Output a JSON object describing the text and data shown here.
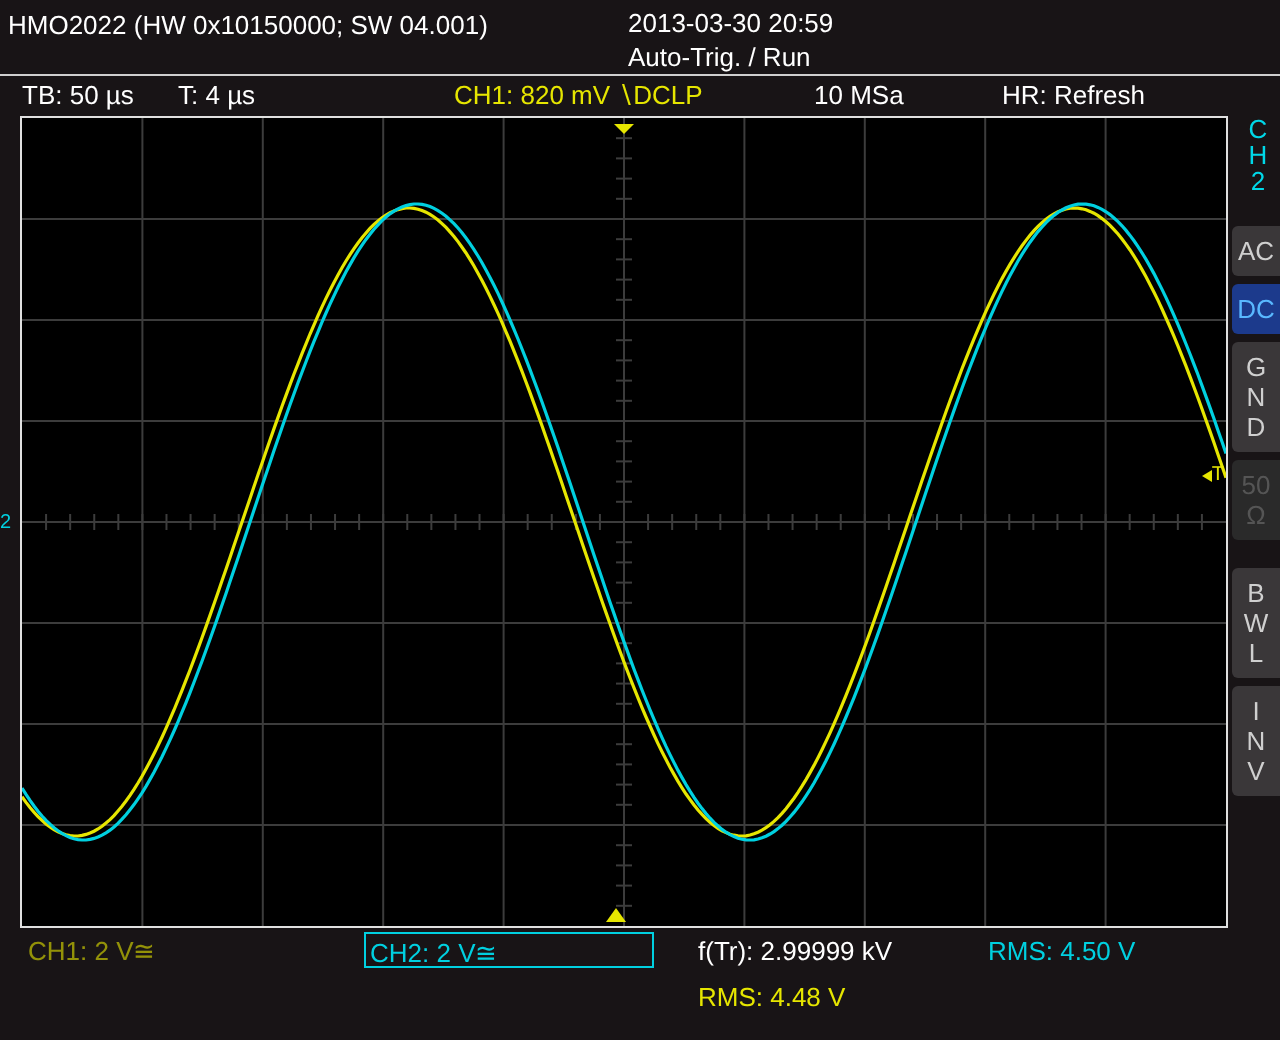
{
  "header": {
    "device": "HMO2022 (HW 0x10150000; SW 04.001)",
    "datetime": "2013-03-30 20:59",
    "trigger_mode": "Auto-Trig. / Run"
  },
  "info_bar": {
    "timebase": "TB: 50 µs",
    "trigger_time": "T: 4 µs",
    "trigger_source": "CH1: 820 mV ∖DCLP",
    "sample_rate": "10 MSa",
    "acquisition": "HR: Refresh"
  },
  "channels": [
    {
      "label": "CH1: 2 V≅",
      "selected": false,
      "color": "#e6e600"
    },
    {
      "label": "CH2: 2 V≅",
      "selected": true,
      "color": "#00d0e0"
    }
  ],
  "markers": {
    "ground_marker": "2",
    "trigger_marker": "T"
  },
  "side_menu": {
    "title": [
      "C",
      "H",
      "2"
    ],
    "buttons": [
      {
        "lines": [
          "AC"
        ],
        "selected": false,
        "disabled": false
      },
      {
        "lines": [
          "DC"
        ],
        "selected": true,
        "disabled": false
      },
      {
        "lines": [
          "G",
          "N",
          "D"
        ],
        "selected": false,
        "disabled": false
      },
      {
        "lines": [
          "50",
          "Ω"
        ],
        "selected": false,
        "disabled": true
      },
      {
        "lines": [
          "B",
          "W",
          "L"
        ],
        "selected": false,
        "disabled": false
      },
      {
        "lines": [
          "I",
          "N",
          "V"
        ],
        "selected": false,
        "disabled": false
      }
    ]
  },
  "measurements": [
    {
      "label": "f(Tr): 2.99999 kV",
      "color": "#ffffff"
    },
    {
      "label": "RMS: 4.50 V",
      "color": "#00d0e0"
    },
    {
      "label": "RMS: 4.48 V",
      "color": "#e6e600"
    }
  ]
}
